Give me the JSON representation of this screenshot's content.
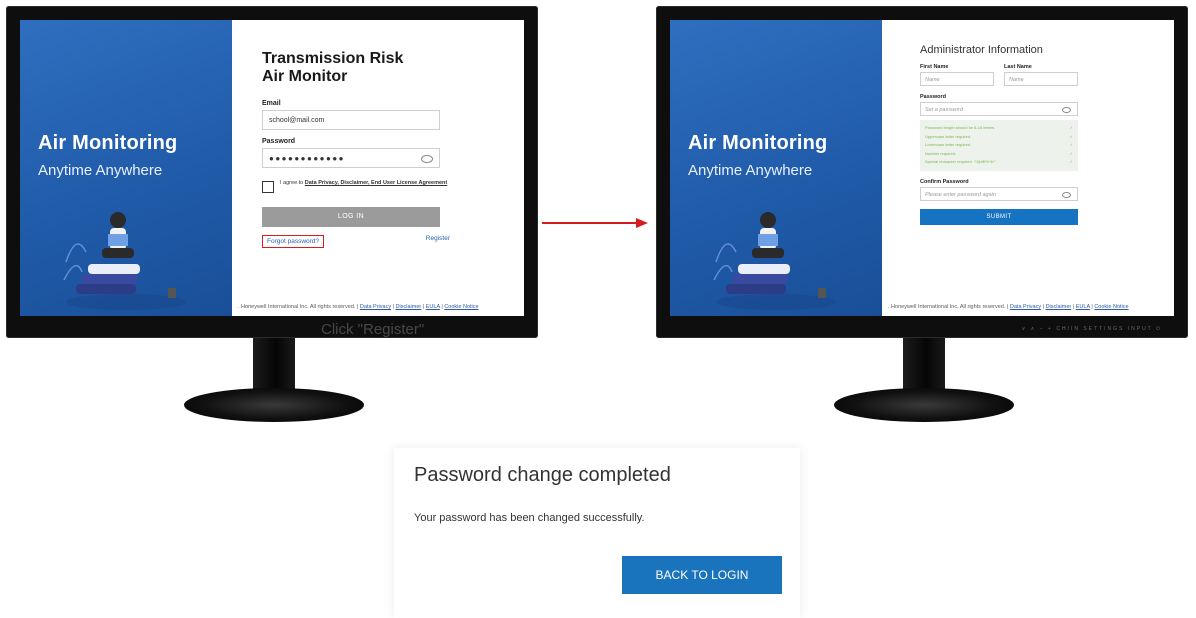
{
  "left_screen": {
    "hero_title": "Air Monitoring",
    "hero_subtitle": "Anytime Anywhere",
    "app_title_line1": "Transmission Risk",
    "app_title_line2": "Air Monitor",
    "email_label": "Email",
    "email_value": "school@mail.com",
    "password_label": "Password",
    "password_value": "●●●●●●●●●●●●",
    "agree_prefix": "I agree to ",
    "agree_link": "Data Privacy, Disclaimer, End User License Agreement",
    "login_button": "LOG IN",
    "forgot_link": "Forgot password?",
    "register_link": "Register",
    "footer_text": ". Honeywell International Inc. All rights reserved.  |  ",
    "footer_links": [
      "Data Privacy",
      "Disclaimer",
      "EULA",
      "Cookie Notice"
    ],
    "overlay_text": "Click \"Register\""
  },
  "right_screen": {
    "hero_title": "Air Monitoring",
    "hero_subtitle": "Anytime Anywhere",
    "title": "Administrator Information",
    "first_name_label": "First Name",
    "first_name_placeholder": "Name",
    "last_name_label": "Last Name",
    "last_name_placeholder": "Name",
    "password_label": "Password",
    "password_placeholder": "Set a password",
    "rules": [
      "Password length should be 8-16 letters.",
      "Uppercase letter required.",
      "Lowercase letter required.",
      "Number required.",
      "Special character required. \"!@#$%^&*\"."
    ],
    "confirm_label": "Confirm Password",
    "confirm_placeholder": "Please enter password again",
    "submit_button": "SUBMIT",
    "footer_text": ". Honeywell International Inc. All rights reserved.  |  ",
    "footer_links": [
      "Data Privacy",
      "Disclaimer",
      "EULA",
      "Cookie Notice"
    ],
    "bezel_controls": "∨   ∧   −   +   CH/IN  SETTINGS  INPUT      ⏻"
  },
  "completion": {
    "title": "Password change completed",
    "message": "Your password has been changed successfully.",
    "button": "BACK TO LOGIN"
  },
  "colors": {
    "hero_blue": "#2f6fbf",
    "accent_red": "#d71c1c",
    "primary_button": "#1673c2",
    "rule_green": "#7cb94a"
  }
}
